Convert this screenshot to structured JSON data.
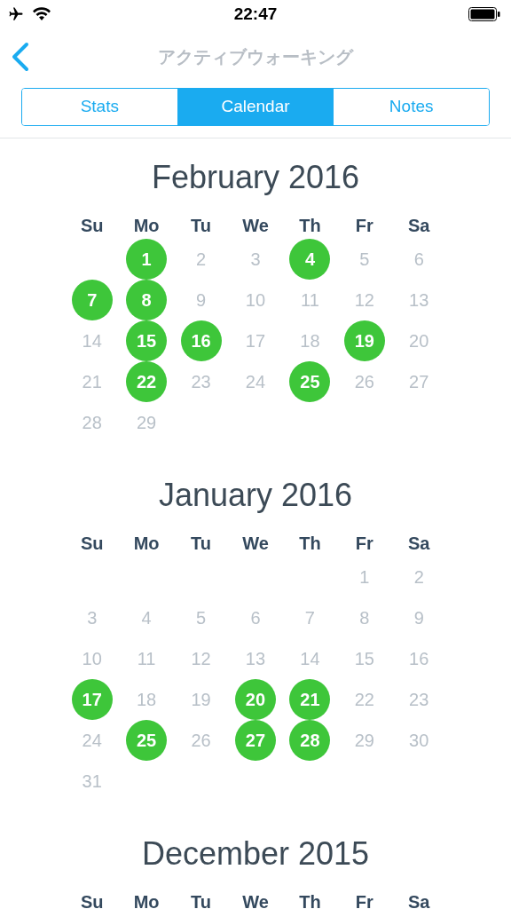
{
  "status_bar": {
    "time": "22:47"
  },
  "nav": {
    "title": "アクティブウォーキング"
  },
  "tabs": [
    {
      "label": "Stats",
      "selected": false
    },
    {
      "label": "Calendar",
      "selected": true
    },
    {
      "label": "Notes",
      "selected": false
    }
  ],
  "months": [
    {
      "title": "February 2016",
      "weekdays": [
        "Su",
        "Mo",
        "Tu",
        "We",
        "Th",
        "Fr",
        "Sa"
      ],
      "weeks": [
        {
          "starts_midweek": true,
          "days": [
            {
              "day": "1",
              "done": true
            },
            {
              "day": "2",
              "done": false
            },
            {
              "day": "3",
              "done": false
            },
            {
              "day": "4",
              "done": true
            },
            {
              "day": "5",
              "done": false
            },
            {
              "day": "6",
              "done": false
            }
          ]
        },
        {
          "starts_midweek": false,
          "days": [
            {
              "day": "7",
              "done": true
            },
            {
              "day": "8",
              "done": true
            },
            {
              "day": "9",
              "done": false
            },
            {
              "day": "10",
              "done": false
            },
            {
              "day": "11",
              "done": false
            },
            {
              "day": "12",
              "done": false
            },
            {
              "day": "13",
              "done": false
            }
          ]
        },
        {
          "starts_midweek": false,
          "days": [
            {
              "day": "14",
              "done": false
            },
            {
              "day": "15",
              "done": true
            },
            {
              "day": "16",
              "done": true
            },
            {
              "day": "17",
              "done": false
            },
            {
              "day": "18",
              "done": false
            },
            {
              "day": "19",
              "done": true
            },
            {
              "day": "20",
              "done": false
            }
          ]
        },
        {
          "starts_midweek": false,
          "days": [
            {
              "day": "21",
              "done": false
            },
            {
              "day": "22",
              "done": true
            },
            {
              "day": "23",
              "done": false
            },
            {
              "day": "24",
              "done": false
            },
            {
              "day": "25",
              "done": true
            },
            {
              "day": "26",
              "done": false
            },
            {
              "day": "27",
              "done": false
            }
          ]
        },
        {
          "starts_midweek": false,
          "days": [
            {
              "day": "28",
              "done": false
            },
            {
              "day": "29",
              "done": false
            }
          ]
        }
      ]
    },
    {
      "title": "January 2016",
      "weekdays": [
        "Su",
        "Mo",
        "Tu",
        "We",
        "Th",
        "Fr",
        "Sa"
      ],
      "weeks": [
        {
          "starts_midweek": true,
          "days": [
            {
              "day": "1",
              "done": false
            },
            {
              "day": "2",
              "done": false
            }
          ]
        },
        {
          "starts_midweek": false,
          "days": [
            {
              "day": "3",
              "done": false
            },
            {
              "day": "4",
              "done": false
            },
            {
              "day": "5",
              "done": false
            },
            {
              "day": "6",
              "done": false
            },
            {
              "day": "7",
              "done": false
            },
            {
              "day": "8",
              "done": false
            },
            {
              "day": "9",
              "done": false
            }
          ]
        },
        {
          "starts_midweek": false,
          "days": [
            {
              "day": "10",
              "done": false
            },
            {
              "day": "11",
              "done": false
            },
            {
              "day": "12",
              "done": false
            },
            {
              "day": "13",
              "done": false
            },
            {
              "day": "14",
              "done": false
            },
            {
              "day": "15",
              "done": false
            },
            {
              "day": "16",
              "done": false
            }
          ]
        },
        {
          "starts_midweek": false,
          "days": [
            {
              "day": "17",
              "done": true
            },
            {
              "day": "18",
              "done": false
            },
            {
              "day": "19",
              "done": false
            },
            {
              "day": "20",
              "done": true
            },
            {
              "day": "21",
              "done": true
            },
            {
              "day": "22",
              "done": false
            },
            {
              "day": "23",
              "done": false
            }
          ]
        },
        {
          "starts_midweek": false,
          "days": [
            {
              "day": "24",
              "done": false
            },
            {
              "day": "25",
              "done": true
            },
            {
              "day": "26",
              "done": false
            },
            {
              "day": "27",
              "done": true
            },
            {
              "day": "28",
              "done": true
            },
            {
              "day": "29",
              "done": false
            },
            {
              "day": "30",
              "done": false
            }
          ]
        },
        {
          "starts_midweek": false,
          "days": [
            {
              "day": "31",
              "done": false
            }
          ]
        }
      ]
    },
    {
      "title": "December 2015",
      "weekdays": [
        "Su",
        "Mo",
        "Tu",
        "We",
        "Th",
        "Fr",
        "Sa"
      ]
    }
  ]
}
